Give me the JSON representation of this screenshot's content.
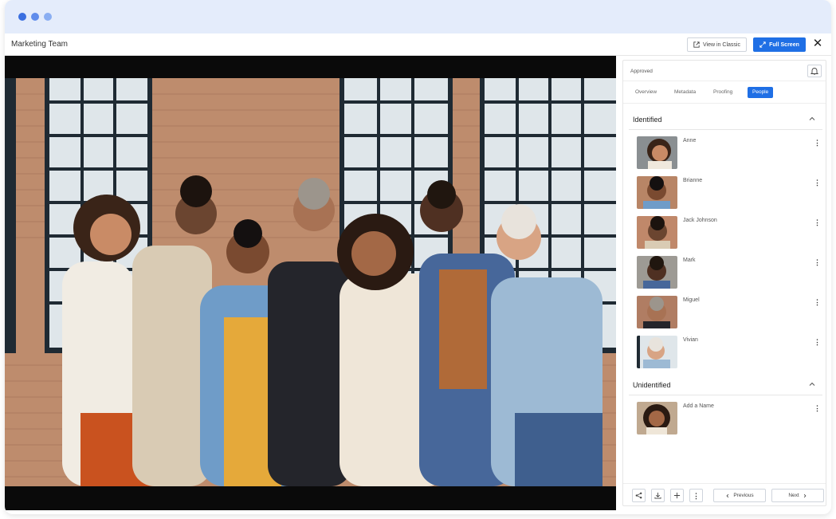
{
  "window": {
    "title": "Marketing Team"
  },
  "header": {
    "view_classic_label": "View in Classic",
    "full_screen_label": "Full Screen"
  },
  "panel": {
    "status": "Approved",
    "tabs": [
      {
        "label": "Overview",
        "active": false
      },
      {
        "label": "Metadata",
        "active": false
      },
      {
        "label": "Proofing",
        "active": false
      },
      {
        "label": "People",
        "active": true
      }
    ],
    "identified": {
      "heading": "Identified",
      "people": [
        {
          "name": "Anne"
        },
        {
          "name": "Brianne"
        },
        {
          "name": "Jack Johnson"
        },
        {
          "name": "Mark"
        },
        {
          "name": "Miguel"
        },
        {
          "name": "Vivian"
        }
      ]
    },
    "unidentified": {
      "heading": "Unidentified",
      "people": [
        {
          "name": "Add a Name"
        }
      ]
    },
    "footer": {
      "previous_label": "Previous",
      "next_label": "Next"
    }
  },
  "colors": {
    "accent": "#1f6fe5",
    "titlebar": "#e4ecfb"
  },
  "icons": [
    "external-link-icon",
    "expand-icon",
    "close-icon",
    "bell-icon",
    "chevron-up-icon",
    "kebab-icon",
    "share-icon",
    "download-icon",
    "plus-icon",
    "chevron-left-icon",
    "chevron-right-icon"
  ]
}
